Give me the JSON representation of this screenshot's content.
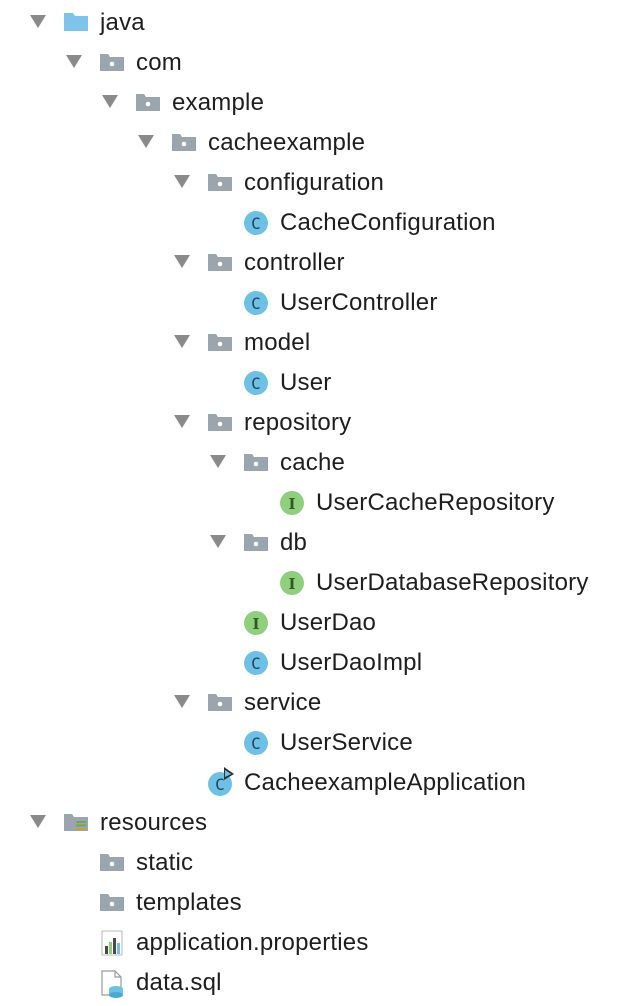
{
  "project_tree": {
    "nodes": [
      {
        "label": "java",
        "depth": 0,
        "expanded": true,
        "icon": "source-folder-icon"
      },
      {
        "label": "com",
        "depth": 1,
        "expanded": true,
        "icon": "package-folder-icon"
      },
      {
        "label": "example",
        "depth": 2,
        "expanded": true,
        "icon": "package-folder-icon"
      },
      {
        "label": "cacheexample",
        "depth": 3,
        "expanded": true,
        "icon": "package-folder-icon"
      },
      {
        "label": "configuration",
        "depth": 4,
        "expanded": true,
        "icon": "package-folder-icon"
      },
      {
        "label": "CacheConfiguration",
        "depth": 5,
        "expanded": null,
        "icon": "class-icon"
      },
      {
        "label": "controller",
        "depth": 4,
        "expanded": true,
        "icon": "package-folder-icon"
      },
      {
        "label": "UserController",
        "depth": 5,
        "expanded": null,
        "icon": "class-icon"
      },
      {
        "label": "model",
        "depth": 4,
        "expanded": true,
        "icon": "package-folder-icon"
      },
      {
        "label": "User",
        "depth": 5,
        "expanded": null,
        "icon": "class-icon"
      },
      {
        "label": "repository",
        "depth": 4,
        "expanded": true,
        "icon": "package-folder-icon"
      },
      {
        "label": "cache",
        "depth": 5,
        "expanded": true,
        "icon": "package-folder-icon"
      },
      {
        "label": "UserCacheRepository",
        "depth": 6,
        "expanded": null,
        "icon": "interface-icon"
      },
      {
        "label": "db",
        "depth": 5,
        "expanded": true,
        "icon": "package-folder-icon"
      },
      {
        "label": "UserDatabaseRepository",
        "depth": 6,
        "expanded": null,
        "icon": "interface-icon"
      },
      {
        "label": "UserDao",
        "depth": 5,
        "expanded": null,
        "icon": "interface-icon"
      },
      {
        "label": "UserDaoImpl",
        "depth": 5,
        "expanded": null,
        "icon": "class-icon"
      },
      {
        "label": "service",
        "depth": 4,
        "expanded": true,
        "icon": "package-folder-icon"
      },
      {
        "label": "UserService",
        "depth": 5,
        "expanded": null,
        "icon": "class-icon"
      },
      {
        "label": "CacheexampleApplication",
        "depth": 4,
        "expanded": null,
        "icon": "spring-boot-class-icon"
      },
      {
        "label": "resources",
        "depth": 0,
        "expanded": true,
        "icon": "resources-folder-icon"
      },
      {
        "label": "static",
        "depth": 1,
        "expanded": null,
        "icon": "package-folder-icon"
      },
      {
        "label": "templates",
        "depth": 1,
        "expanded": null,
        "icon": "package-folder-icon"
      },
      {
        "label": "application.properties",
        "depth": 1,
        "expanded": null,
        "icon": "properties-file-icon"
      },
      {
        "label": "data.sql",
        "depth": 1,
        "expanded": null,
        "icon": "sql-file-icon"
      }
    ]
  },
  "icon_glyphs": {
    "class-icon": "C",
    "spring-boot-class-icon": "C",
    "interface-icon": "I"
  },
  "colors": {
    "source-folder": "#7fc4e8",
    "package-folder": "#9aa5ad",
    "class-badge": "#6ec1e4",
    "interface-badge": "#8fcf7e",
    "arrow": "#8a8a8a",
    "text": "#1e1e1e"
  }
}
